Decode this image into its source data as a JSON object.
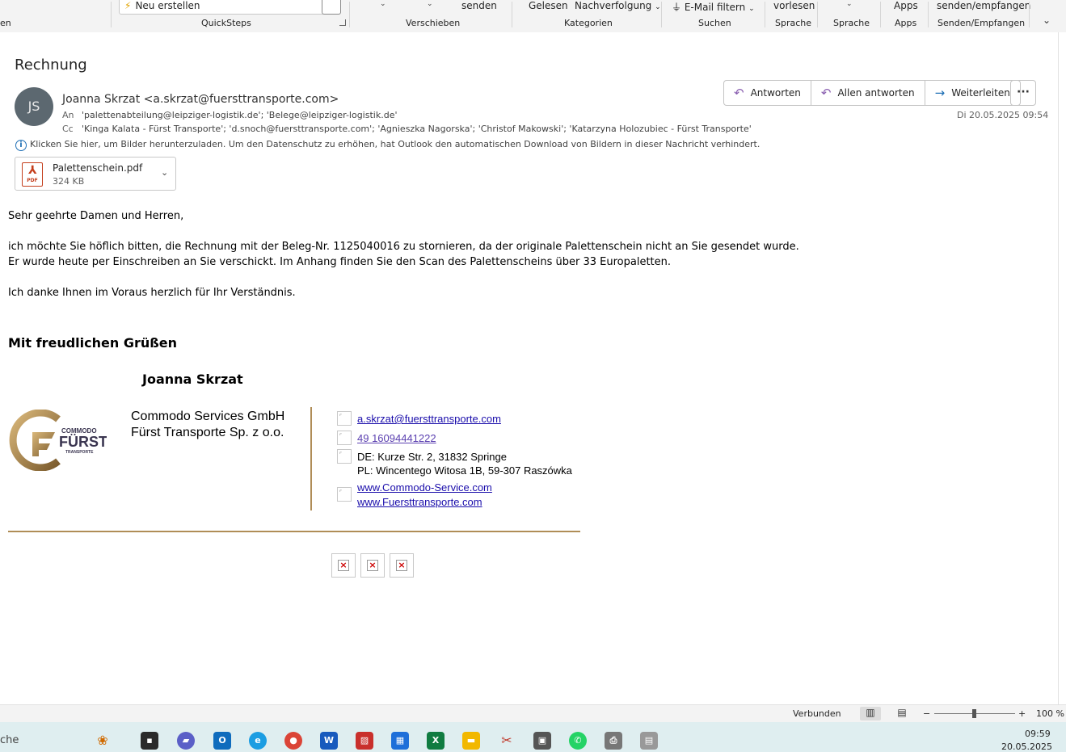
{
  "ribbon": {
    "partial_left": "en",
    "quicksteps_item": "Neu erstellen",
    "groups": {
      "quicksteps": "QuickSteps",
      "verschieben": "Verschieben",
      "kategorien": "Kategorien",
      "suchen": "Suchen",
      "sprache1": "Sprache",
      "sprache2": "Sprache",
      "apps": "Apps",
      "senden_empfangen": "Senden/Empfangen"
    },
    "buttons": {
      "senden": "senden",
      "gelesen": "Gelesen",
      "nachverfolgung": "Nachverfolgung",
      "email_filtern": "E-Mail filtern",
      "vorlesen": "vorlesen",
      "apps": "Apps",
      "senden_empfangen": "senden/empfangen"
    }
  },
  "email": {
    "subject": "Rechnung",
    "avatar_initials": "JS",
    "sender": "Joanna Skrzat <a.skrzat@fuersttransporte.com>",
    "to_label": "An",
    "to": "'palettenabteilung@leipziger-logistik.de'; 'Belege@leipziger-logistik.de'",
    "cc_label": "Cc",
    "cc": "'Kinga Kalata - Fürst Transporte'; 'd.snoch@fuersttransporte.com'; 'Agnieszka Nagorska'; 'Christof Makowski'; 'Katarzyna Holozubiec - Fürst Transporte'",
    "date": "Di 20.05.2025 09:54",
    "info_bar": "Klicken Sie hier, um Bilder herunterzuladen. Um den Datenschutz zu erhöhen, hat Outlook den automatischen Download von Bildern in dieser Nachricht verhindert.",
    "actions": {
      "reply": "Antworten",
      "reply_all": "Allen antworten",
      "forward": "Weiterleiten",
      "more": "···"
    },
    "attachment": {
      "name": "Palettenschein.pdf",
      "size": "324 KB",
      "icon_text": "PDF"
    },
    "body": {
      "greeting": "Sehr geehrte Damen und Herren,",
      "line1": "ich möchte Sie höflich bitten, die Rechnung mit der Beleg-Nr. 1125040016 zu stornieren, da der originale Palettenschein nicht an Sie gesendet wurde.",
      "line2": "Er wurde heute per Einschreiben an Sie verschickt. Im Anhang finden Sie den Scan des Palettenscheins über 33 Europaletten.",
      "thanks": "Ich danke Ihnen im Voraus herzlich für Ihr Verständnis.",
      "closing": "Mit freudlichen Grüßen",
      "signature_name": "Joanna Skrzat"
    },
    "signature": {
      "logo_line1": "COMMODO",
      "logo_line2": "FÜRST",
      "logo_line3": "TRANSPORTE",
      "company1": "Commodo Services GmbH",
      "company2": "Fürst Transporte Sp. z o.o.",
      "email": "a.skrzat@fuersttransporte.com",
      "phone": "49 16094441222",
      "address_de": "DE: Kurze Str. 2, 31832 Springe",
      "address_pl": "PL: Wincentego Witosa 1B, 59-307 Raszówka",
      "web1": "www.Commodo-Service.com",
      "web2": "www.Fuersttransporte.com"
    }
  },
  "statusbar": {
    "connection": "Verbunden",
    "zoom_minus": "−",
    "zoom_plus": "+",
    "zoom_level": "100 %",
    "zoom_fraction": 0.5
  },
  "taskbar": {
    "search_partial": "che",
    "time": "09:59",
    "date": "20.05.2025",
    "apps": [
      "chat",
      "outlook",
      "edge",
      "chrome",
      "word",
      "pdf",
      "store",
      "excel",
      "explorer",
      "snipping",
      "scanner",
      "whatsapp",
      "printer",
      "fax"
    ]
  },
  "colors": {
    "accent_gold": "#b08d57",
    "link_blue": "#1a0dab",
    "reply_purple": "#8a5fb0"
  }
}
